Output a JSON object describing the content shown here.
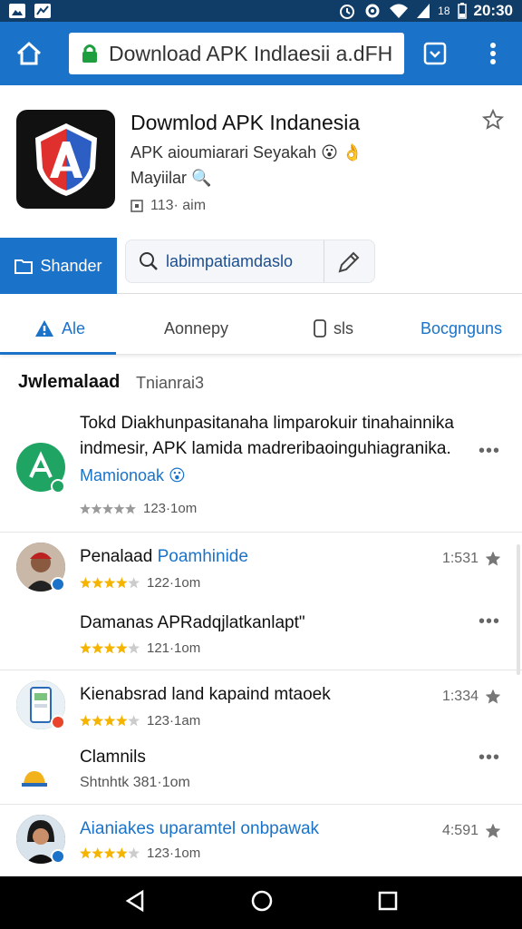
{
  "status_bar": {
    "time": "20:30",
    "battery": "18"
  },
  "browser": {
    "url_text": "Download APK Indlaesii a.dFH"
  },
  "app": {
    "title": "Dowmlod APK Indanesia",
    "developer": "APK aioumiarari Seyakah 😮 👌",
    "category": "Mayiilar 🔍",
    "size": "113· aim"
  },
  "actions": {
    "primary_label": "Shander",
    "search_text": "labimpatiamdaslo"
  },
  "tabs": [
    {
      "label": "Ale"
    },
    {
      "label": "Aonnepy"
    },
    {
      "label": "sls"
    },
    {
      "label": "Bocgnguns"
    }
  ],
  "section": {
    "title": "Jwlemalaad",
    "subtitle": "Tnianrai3"
  },
  "featured": {
    "text_line1": "Tokd Diakhunpasitanaha limparokuir tinahainnika",
    "text_line2": "indmesir, APK lamida madreribaoinguhiagranika.",
    "link": "Mamionoak 😮",
    "rating_text": "123·1om"
  },
  "reviews": [
    {
      "name": "Penalaad",
      "name_link": "Poamhinide",
      "time": "1:531",
      "rating_text": "122·1om",
      "stars": 4
    },
    {
      "name": "Damanas APRadqjlatkanlapt\"",
      "rating_text": "121·1om",
      "stars": 4
    },
    {
      "name": "Kienabsrad land kapaind mtaoek",
      "time": "1:334",
      "rating_text": "123·1am",
      "stars": 4
    },
    {
      "name": "Clamnils",
      "rating_text": "Shtnhtk  381·1om"
    },
    {
      "name": "Aianiakes uparamtel onbpawak",
      "time": "4:591",
      "rating_text": "123·1om",
      "stars": 4
    }
  ],
  "colors": {
    "primary": "#1a73c9",
    "status_bar": "#0f3d67",
    "star": "#f4b400"
  }
}
